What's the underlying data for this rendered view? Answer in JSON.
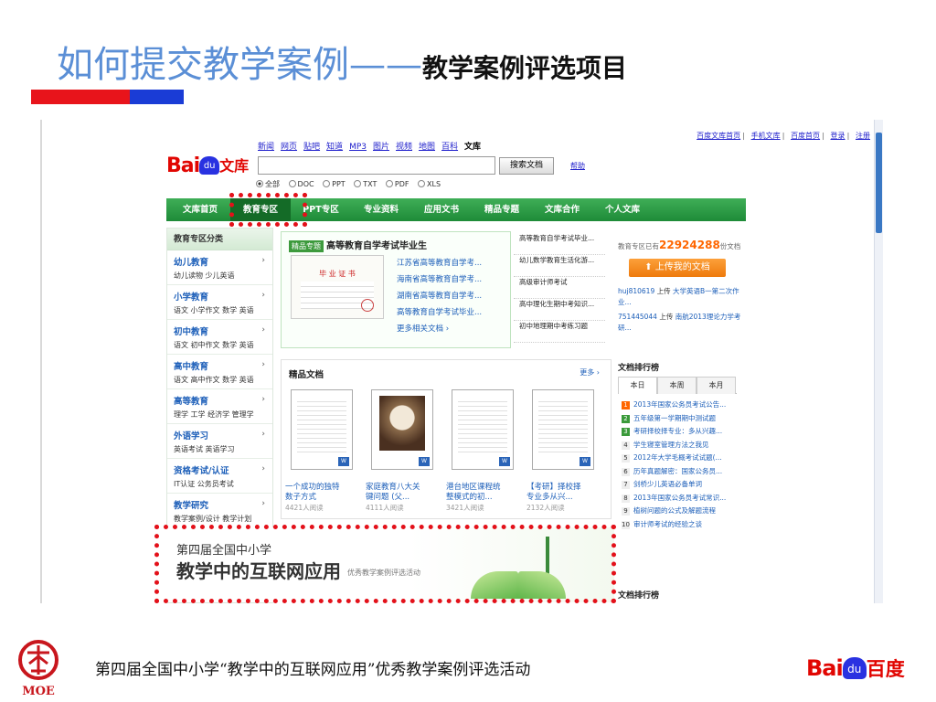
{
  "slide": {
    "title_main": "如何提交教学案例——",
    "title_sub": "教学案例评选项目",
    "footer_text": "第四届全国中小学“教学中的互联网应用”优秀教学案例评选活动",
    "moe_text": "MOE",
    "footer_logo": {
      "bai": "Bai",
      "du": "du",
      "name": "百度"
    }
  },
  "screenshot": {
    "top_links": [
      "百度文库首页",
      "手机文库",
      "百度首页",
      "登录",
      "注册"
    ],
    "logo": {
      "bai": "Bai",
      "du": "du",
      "name": "文库"
    },
    "nav_links": [
      "新闻",
      "网页",
      "贴吧",
      "知道",
      "MP3",
      "图片",
      "视频",
      "地图",
      "百科"
    ],
    "nav_current": "文库",
    "search": {
      "value": "",
      "button": "搜索文档",
      "help": "帮助"
    },
    "filetypes": [
      "全部",
      "DOC",
      "PPT",
      "TXT",
      "PDF",
      "XLS"
    ],
    "green_nav": [
      "文库首页",
      "教育专区",
      "PPT专区",
      "专业资料",
      "应用文书",
      "精品专题",
      "文库合作",
      "个人文库"
    ],
    "left_panel": {
      "title": "教育专区分类",
      "categories": [
        {
          "name": "幼儿教育",
          "sub": "幼儿读物  少儿英语"
        },
        {
          "name": "小学教育",
          "sub": "语文  小学作文  数学  英语"
        },
        {
          "name": "初中教育",
          "sub": "语文  初中作文  数学  英语"
        },
        {
          "name": "高中教育",
          "sub": "语文  高中作文  数学  英语"
        },
        {
          "name": "高等教育",
          "sub": "理学  工学  经济学  管理学"
        },
        {
          "name": "外语学习",
          "sub": "英语考试  英语学习"
        },
        {
          "name": "资格考试/认证",
          "sub": "IT认证  公务员考试"
        },
        {
          "name": "教学研究",
          "sub": "教学案例/设计  教学计划"
        }
      ],
      "arrow": "›"
    },
    "featured": {
      "tag": "精品专题",
      "title": "高等教育自学考试毕业生",
      "cert_title": "毕 业 证 书",
      "links": [
        "江苏省高等教育自学考...",
        "海南省高等教育自学考...",
        "湖南省高等教育自学考...",
        "高等教育自学考试毕业...",
        "更多相关文档 ›"
      ],
      "right_items": [
        "高等教育自学考试毕业...",
        "幼儿数学教育生活化游...",
        "高级审计师考试",
        "高中理化生期中考知识...",
        "初中地理期中考练习题"
      ]
    },
    "right_panel": {
      "count_prefix": "教育专区已有",
      "count_value": "22924288",
      "count_suffix": "份文档",
      "upload": "上传我的文档",
      "uploads": [
        {
          "user": "huj810619",
          "action": "上传",
          "doc": "大学英语B一第二次作业..."
        },
        {
          "user": "751445044",
          "action": "上传",
          "doc": "南航2013理论力学考研..."
        }
      ]
    },
    "ranking": {
      "title": "文档排行榜",
      "tabs": [
        "本日",
        "本周",
        "本月"
      ],
      "items": [
        "2013年国家公务员考试公告...",
        "五年级第一学期期中测试题",
        "考研择校择专业：多从兴趣...",
        "学生寝室管理方法之我见",
        "2012年大学毛概考试试题(...",
        "历年真题解密：国家公务员...",
        "剑桥少儿英语必备单词",
        "2013年国家公务员考试常识...",
        "植树问题的公式及解题流程",
        "审计师考试的经验之谈"
      ],
      "title2": "文档排行榜"
    },
    "docs": {
      "title": "精品文档",
      "more": "更多 ›",
      "items": [
        {
          "title1": "一个成功的独特",
          "title2": "数子方式",
          "views": "4421人阅读"
        },
        {
          "title1": "家庭教育八大关",
          "title2": "键问题 (父...",
          "views": "4111人阅读"
        },
        {
          "title1": "港台地区课程统",
          "title2": "整模式的初...",
          "views": "3421人阅读"
        },
        {
          "title1": "【考研】择校择",
          "title2": "专业多从兴...",
          "views": "2132人阅读"
        }
      ],
      "badge": "W"
    },
    "banner": {
      "line1": "第四届全国中小学",
      "line2": "教学中的互联网应用",
      "line3": "优秀教学案例评选活动"
    }
  },
  "colors": {
    "title_blue": "#5B8FD6",
    "accent_red": "#E8141B",
    "accent_blue": "#1A3CD6",
    "baidu_green": "#1e8b38"
  }
}
